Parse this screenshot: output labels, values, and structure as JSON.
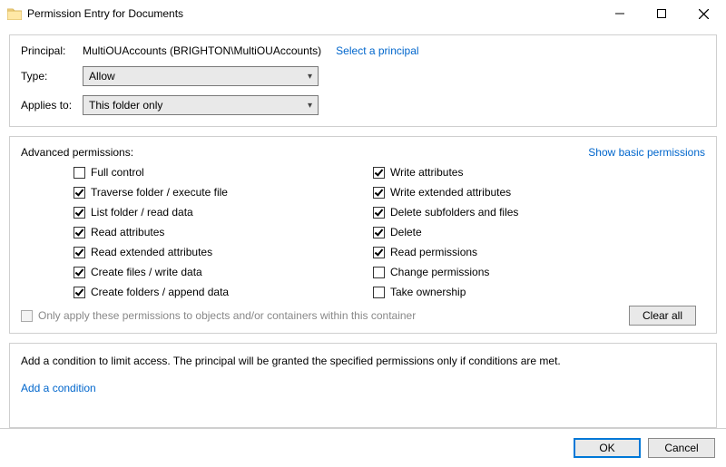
{
  "window": {
    "title": "Permission Entry for Documents"
  },
  "principal": {
    "label": "Principal:",
    "value": "MultiOUAccounts (BRIGHTON\\MultiOUAccounts)",
    "select_link": "Select a principal"
  },
  "type": {
    "label": "Type:",
    "value": "Allow"
  },
  "applies": {
    "label": "Applies to:",
    "value": "This folder only"
  },
  "adv": {
    "heading": "Advanced permissions:",
    "show_basic_link": "Show basic permissions",
    "left": [
      {
        "label": "Full control",
        "checked": false
      },
      {
        "label": "Traverse folder / execute file",
        "checked": true
      },
      {
        "label": "List folder / read data",
        "checked": true
      },
      {
        "label": "Read attributes",
        "checked": true
      },
      {
        "label": "Read extended attributes",
        "checked": true
      },
      {
        "label": "Create files / write data",
        "checked": true
      },
      {
        "label": "Create folders / append data",
        "checked": true
      }
    ],
    "right": [
      {
        "label": "Write attributes",
        "checked": true
      },
      {
        "label": "Write extended attributes",
        "checked": true
      },
      {
        "label": "Delete subfolders and files",
        "checked": true
      },
      {
        "label": "Delete",
        "checked": true
      },
      {
        "label": "Read permissions",
        "checked": true
      },
      {
        "label": "Change permissions",
        "checked": false
      },
      {
        "label": "Take ownership",
        "checked": false
      }
    ],
    "only_apply": "Only apply these permissions to objects and/or containers within this container",
    "clear_all": "Clear all"
  },
  "cond": {
    "desc": "Add a condition to limit access. The principal will be granted the specified permissions only if conditions are met.",
    "add_link": "Add a condition"
  },
  "footer": {
    "ok": "OK",
    "cancel": "Cancel"
  }
}
